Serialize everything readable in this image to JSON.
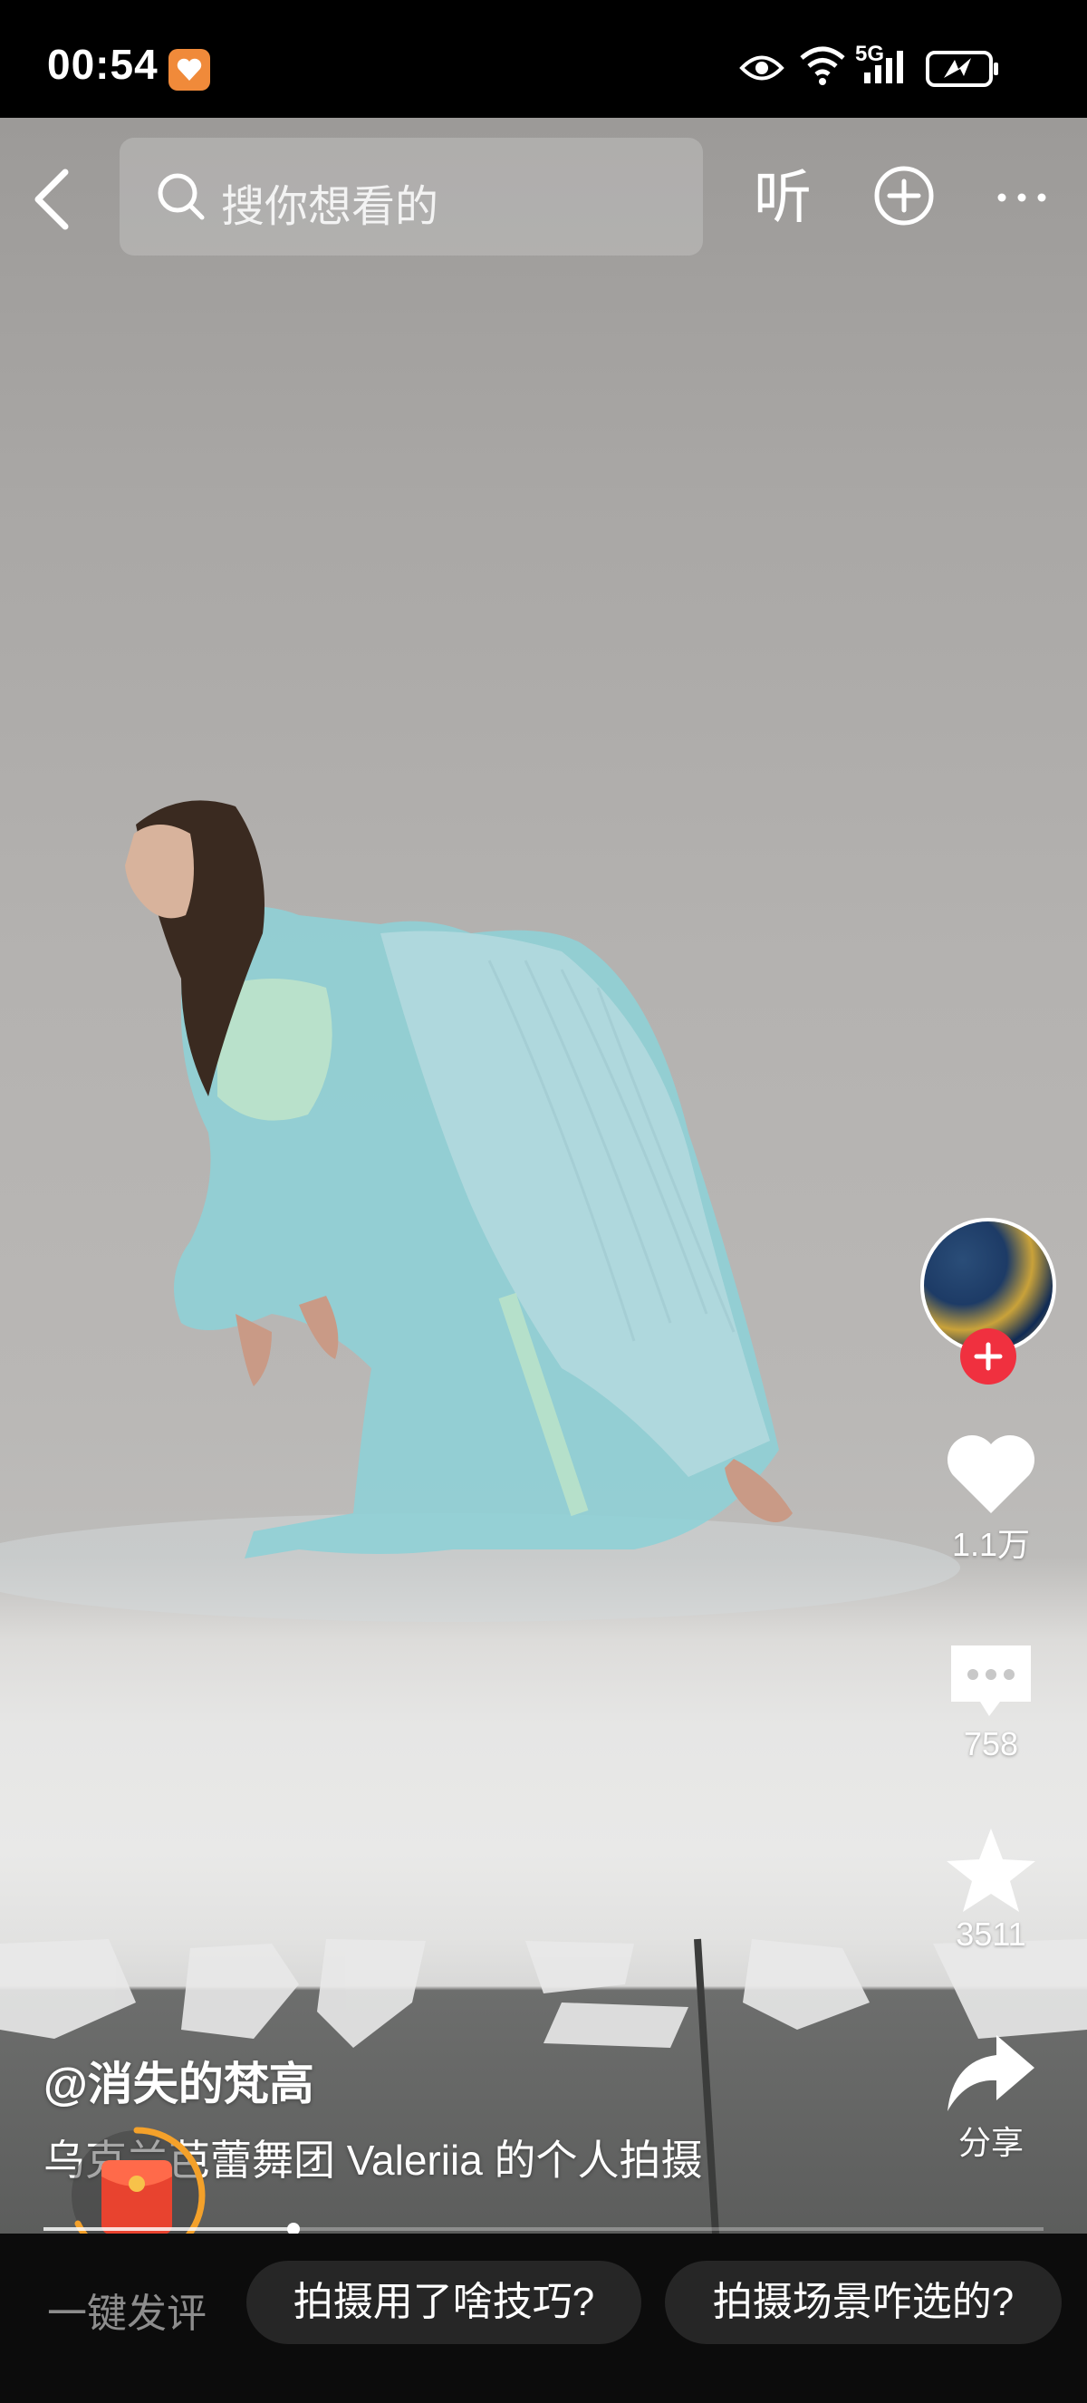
{
  "status_bar": {
    "time": "00:54",
    "network": "5G"
  },
  "top_bar": {
    "search_placeholder": "搜你想看的",
    "listen_label": "听"
  },
  "actions": {
    "likes": "1.1万",
    "comments": "758",
    "favorites": "3511",
    "share_label": "分享"
  },
  "caption": {
    "author": "@消失的梵高",
    "description": "乌克兰芭蕾舞团 Valeriia 的个人拍摄"
  },
  "playback": {
    "progress": 0.25
  },
  "bottom_bar": {
    "quick_comment_label": "一键发评",
    "suggestions": [
      "拍摄用了啥技巧?",
      "拍摄场景咋选的?"
    ]
  },
  "colors": {
    "follow_badge": "#f0303f",
    "red_packet": "#e8432f",
    "red_packet_ring": "#f4a12a",
    "bottom_bar": "#0c0c0c",
    "chip": "#262626"
  }
}
